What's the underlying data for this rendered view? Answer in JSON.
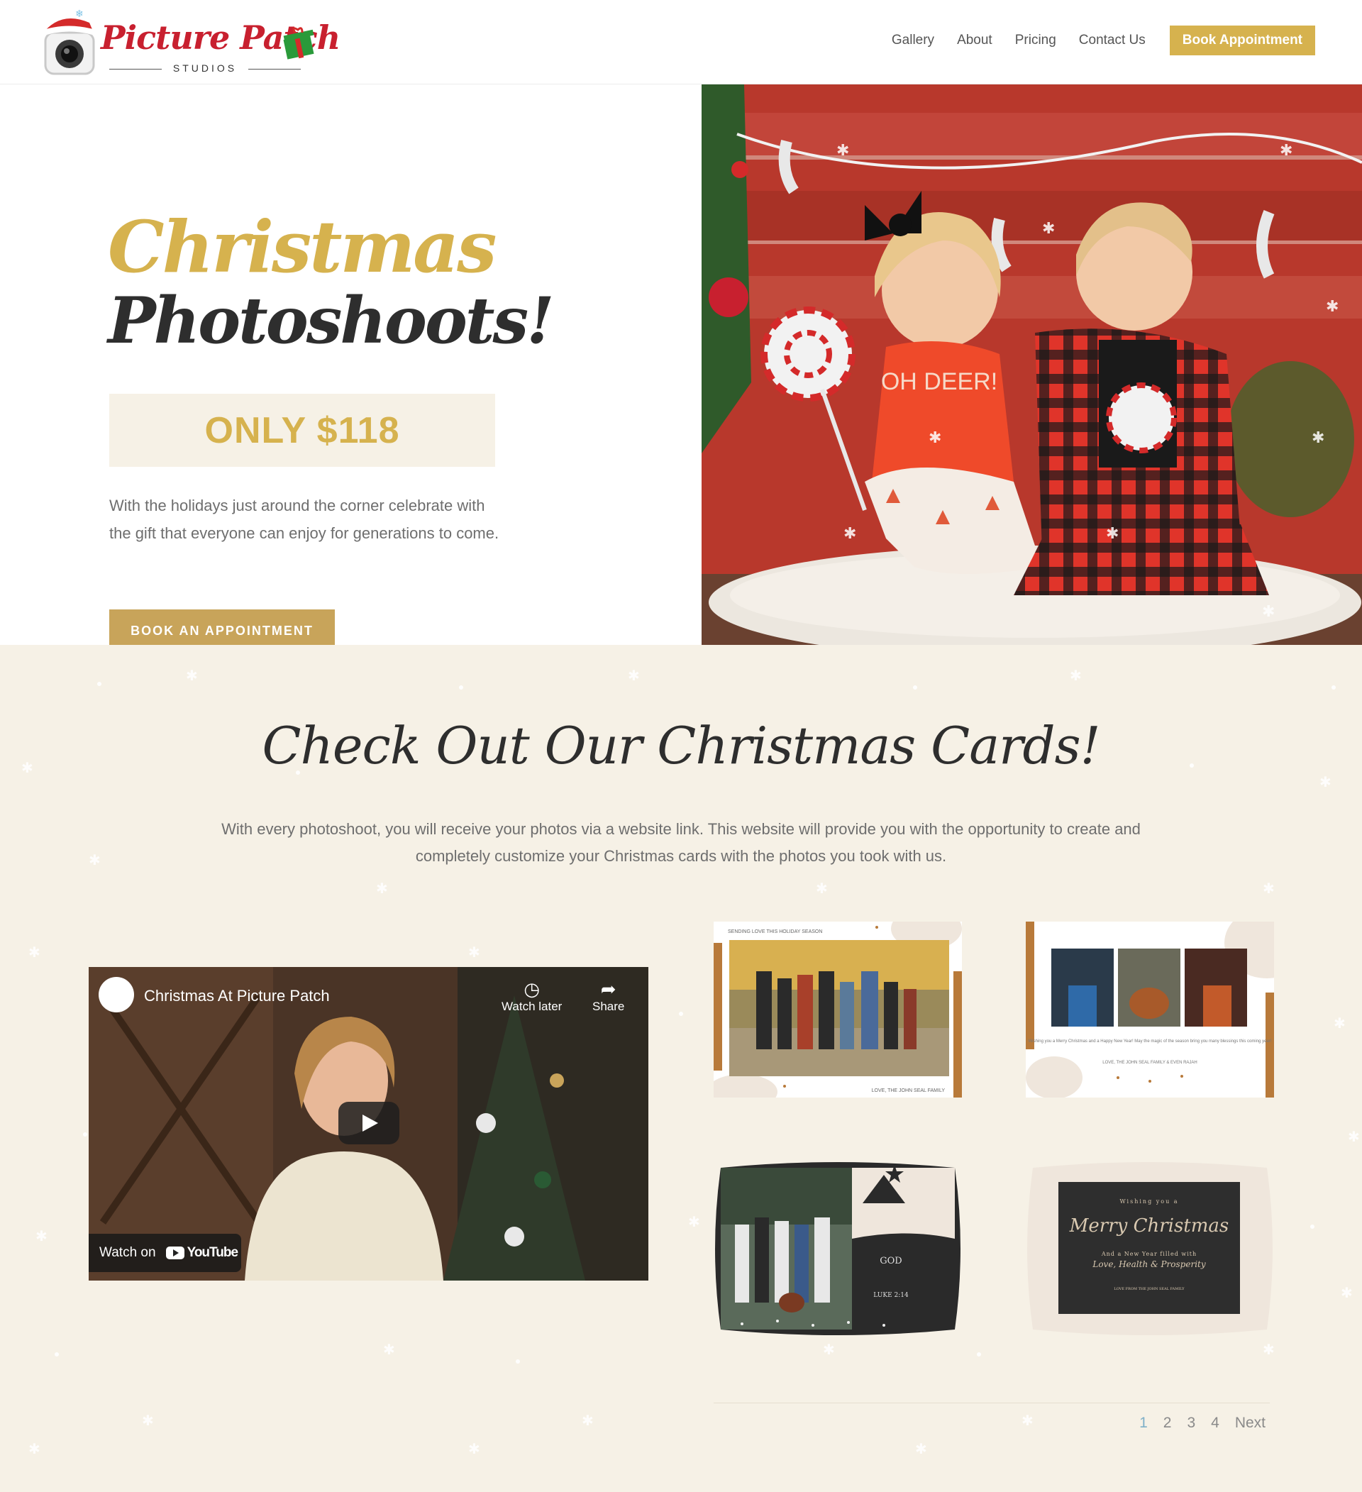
{
  "header": {
    "logo_text": "Picture Patch",
    "logo_sub": "STUDIOS",
    "nav": [
      "Gallery",
      "About",
      "Pricing",
      "Contact Us"
    ],
    "book_label": "Book Appointment"
  },
  "hero": {
    "title_line1": "Christmas",
    "title_line2": "Photoshoots!",
    "price": "ONLY $118",
    "description": "With the holidays just around the corner celebrate with the gift that everyone can enjoy for generations to come.",
    "button": "BOOK AN APPOINTMENT",
    "shirt_text": "OH DEER!"
  },
  "cards_section": {
    "title": "Check Out Our Christmas Cards!",
    "description": "With every photoshoot, you will receive your photos via a website link. This website will provide you with the opportunity to create and completely customize your Christmas cards with the photos you took with us.",
    "video": {
      "title": "Christmas At Picture Patch",
      "watch_later": "Watch later",
      "share": "Share",
      "watch_on": "Watch on",
      "youtube": "YouTube"
    },
    "card1_header": "SENDING LOVE THIS HOLIDAY SEASON",
    "card1_footer": "LOVE, THE JOHN SEAL FAMILY",
    "card2_text": "Wishing you a Merry Christmas and a Happy New Year! May the magic of the season bring you many blessings this coming year!",
    "card2_footer": "LOVE, THE JOHN SEAL FAMILY & EVEN RAJAH",
    "card3_god": "GOD",
    "card3_luke": "LUKE 2:14",
    "card4_line1": "Wishing you a",
    "card4_line2": "Merry Christmas",
    "card4_line3": "And a New Year filled with",
    "card4_line4": "Love, Health & Prosperity",
    "card4_line5": "LOVE FROM THE JOHN SEAL FAMILY",
    "pagination": [
      "1",
      "2",
      "3",
      "4",
      "Next"
    ]
  },
  "colors": {
    "gold": "#d6b24e",
    "cream": "#f6f1e6",
    "dark": "#2e2e2e",
    "logo_red": "#c8202f"
  }
}
